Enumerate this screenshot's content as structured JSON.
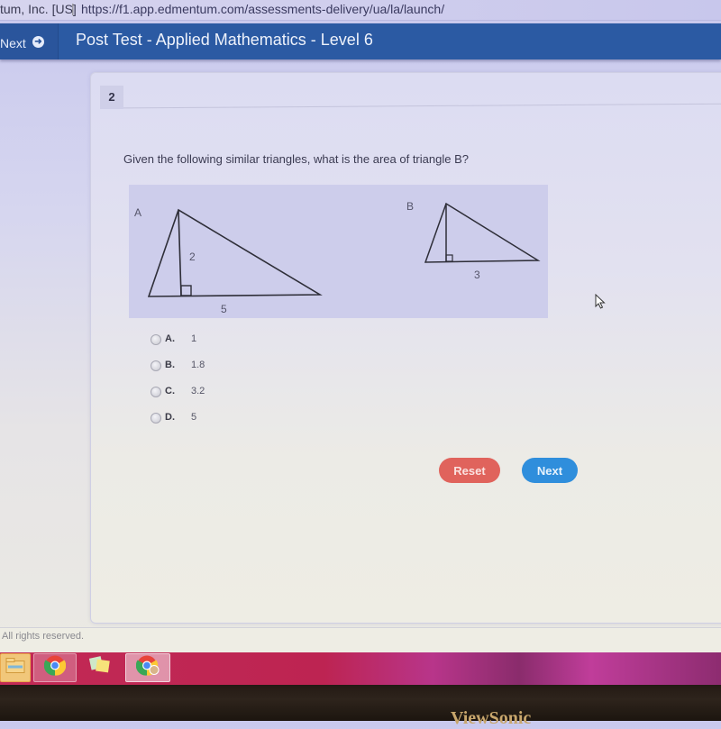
{
  "browser": {
    "org_label": "tum, Inc. [US]",
    "url": "https://f1.app.edmentum.com/assessments-delivery/ua/la/launch/"
  },
  "topnav": {
    "next_label": "Next",
    "next_icon": "arrow-right-circle-icon",
    "title": "Post Test - Applied Mathematics - Level 6"
  },
  "question": {
    "number": "2",
    "text": "Given the following similar triangles, what is the area of triangle B?",
    "figure": {
      "triangle_a": {
        "label": "A",
        "height_label": "2",
        "base_label": "5"
      },
      "triangle_b": {
        "label": "B",
        "base_label": "3"
      }
    },
    "options": [
      {
        "letter": "A.",
        "value": "1"
      },
      {
        "letter": "B.",
        "value": "1.8"
      },
      {
        "letter": "C.",
        "value": "3.2"
      },
      {
        "letter": "D.",
        "value": "5"
      }
    ]
  },
  "actions": {
    "reset_label": "Reset",
    "next_label": "Next",
    "reset_color": "#e0635c",
    "next_color": "#2f8edc"
  },
  "footer": {
    "copyright": "All rights reserved."
  },
  "taskbar": {
    "items": [
      {
        "name": "file-explorer",
        "icon": "folder-icon"
      },
      {
        "name": "chrome",
        "icon": "chrome-icon"
      },
      {
        "name": "sticky-notes",
        "icon": "sticky-notes-icon"
      },
      {
        "name": "chrome-profile",
        "icon": "chrome-icon"
      }
    ]
  },
  "monitor": {
    "brand_partial": "ViewSonic"
  }
}
